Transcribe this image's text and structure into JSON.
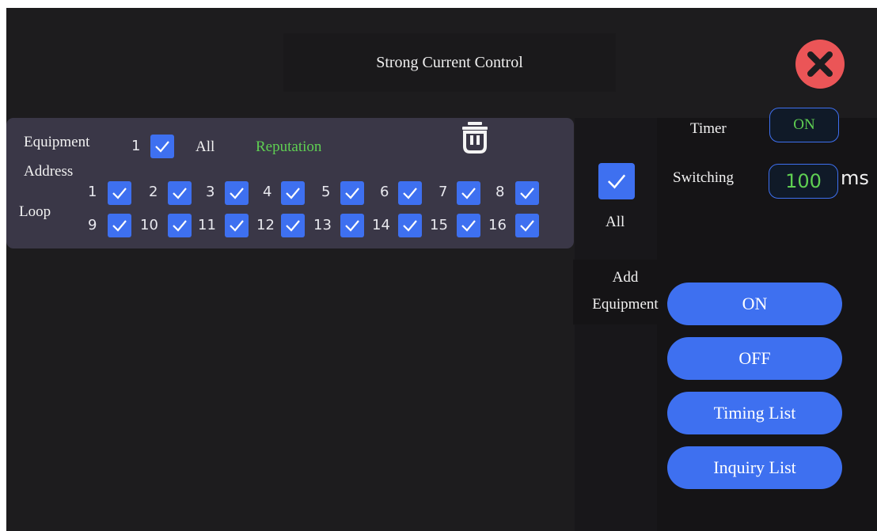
{
  "header": {
    "title": "Strong Current Control"
  },
  "close_icon": "close-icon",
  "equipment": {
    "label": "Equipment",
    "number": "1",
    "all_label": "All",
    "reputation_label": "Reputation",
    "address_label": "Address",
    "loop_label": "Loop",
    "loops_row1": [
      "1",
      "2",
      "3",
      "4",
      "5",
      "6",
      "7",
      "8"
    ],
    "loops_row2": [
      "9",
      "10",
      "11",
      "12",
      "13",
      "14",
      "15",
      "16"
    ]
  },
  "side": {
    "all_label": "All",
    "add_equipment_line1": "Add",
    "add_equipment_line2": "Equipment"
  },
  "settings": {
    "timer_label": "Timer",
    "timer_value": "ON",
    "switching_label": "Switching",
    "switching_value": "100",
    "switching_unit": "ms"
  },
  "actions": {
    "on_label": "ON",
    "off_label": "OFF",
    "timing_list_label": "Timing List",
    "inquiry_list_label": "Inquiry List"
  },
  "colors": {
    "accent": "#3e70f0",
    "green_text": "#5fcf52",
    "close": "#eb5557",
    "background": "#1d1c1e",
    "card": "#3a3747"
  }
}
